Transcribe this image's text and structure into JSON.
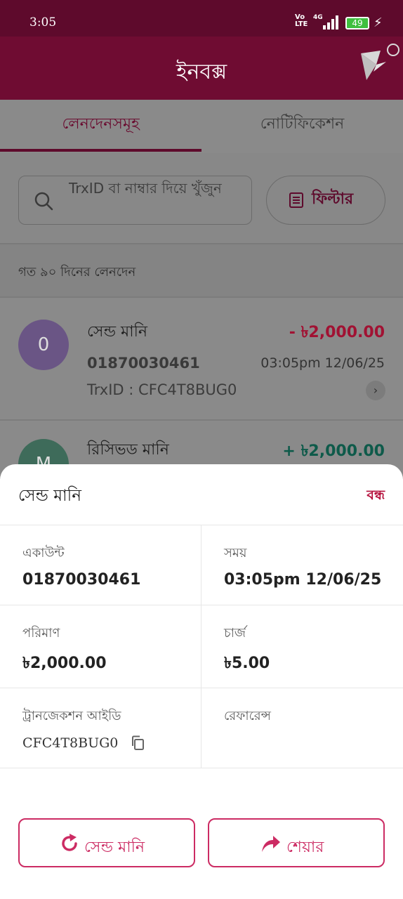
{
  "status_bar": {
    "time": "3:05",
    "network_top": "Vo",
    "network_bottom": "LTE",
    "network_gen": "4G",
    "battery": "49"
  },
  "app_bar": {
    "title": "ইনবক্স"
  },
  "tabs": [
    {
      "label": "লেনদেনসমূহ",
      "active": true
    },
    {
      "label": "নোটিফিকেশন",
      "active": false
    }
  ],
  "search": {
    "placeholder": "TrxID বা নাম্বার দিয়ে খুঁজুন",
    "filter_label": "ফিল্টার"
  },
  "section": {
    "label": "গত ৯০ দিনের লেনদেন"
  },
  "transactions": [
    {
      "avatar": "0",
      "type": "সেন্ড মানি",
      "amount": "- ৳2,000.00",
      "number": "01870030461",
      "time": "03:05pm 12/06/25",
      "trx": "TrxID : CFC4T8BUG0",
      "amount_color": "#a11233",
      "avatar_color": "#6a5585"
    },
    {
      "avatar": "M",
      "type": "রিসিভড মানি",
      "amount": "+ ৳2,000.00",
      "amount_color": "#0e5a4a",
      "avatar_color": "#3e6b5a"
    }
  ],
  "sheet": {
    "title": "সেন্ড মানি",
    "close_label": "বন্ধ",
    "fields": {
      "account_label": "একাউন্ট",
      "account_value": "01870030461",
      "time_label": "সময়",
      "time_value": "03:05pm 12/06/25",
      "amount_label": "পরিমাণ",
      "amount_value": "৳2,000.00",
      "charge_label": "চার্জ",
      "charge_value": "৳5.00",
      "trx_label": "ট্রানজেকশন আইডি",
      "trx_value": "CFC4T8BUG0",
      "reference_label": "রেফারেন্স"
    },
    "actions": {
      "send_again": "সেন্ড মানি",
      "share": "শেয়ার"
    }
  },
  "colors": {
    "brand": "#6f0c32",
    "accent": "#cc2b63",
    "negative": "#b5103c"
  }
}
